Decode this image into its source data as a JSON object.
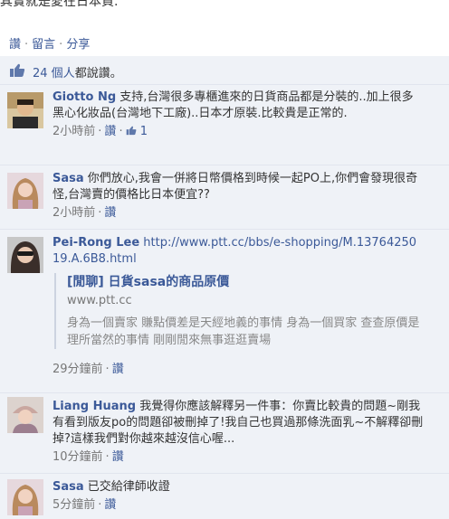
{
  "post": {
    "truncated_text": "其實就是愛在日本買.",
    "actions": {
      "like": "讚",
      "comment": "留言",
      "share": "分享"
    }
  },
  "likes": {
    "count": "24 個人",
    "suffix": "都說讚。"
  },
  "comments": [
    {
      "author": "Giotto Ng",
      "text": "支持,台灣很多專櫃進來的日貨商品都是分裝的..加上很多黑心化妝品(台灣地下工廠)..日本才原裝.比較貴是正常的.",
      "time": "2小時前",
      "like_label": "讚",
      "like_count": "1"
    },
    {
      "author": "Sasa",
      "text": "你們放心,我會一併將日幣價格到時候一起PO上,你們會發現很奇怪,台灣賣的價格比日本便宜??",
      "time": "2小時前",
      "like_label": "讚"
    },
    {
      "author": "Pei-Rong Lee",
      "url": "http://www.ptt.cc/bbs/e-shopping/M.1376425019.A.6B8.html",
      "share_title": "[閒聊] 日貨sasa的商品原價",
      "share_domain": "www.ptt.cc",
      "share_desc": "身為一個賣家 賺點價差是天經地義的事情 身為一個買家 查查原價是理所當然的事情 剛剛閒來無事逛逛賣場",
      "time": "29分鐘前",
      "like_label": "讚"
    },
    {
      "author": "Liang Huang",
      "text": "我覺得你應該解釋另一件事：你賣比較貴的問題~剛我有看到版友po的問題卻被刪掉了!我自己也買過那條洗面乳~不解釋卻刪掉?這樣我們對你越來越沒信心喔...",
      "time": "10分鐘前",
      "like_label": "讚"
    },
    {
      "author": "Sasa",
      "text": "已交給律師收證",
      "time": "5分鐘前",
      "like_label": "讚"
    }
  ],
  "colors": {
    "link": "#3b5998",
    "panel": "#eff2f7",
    "text": "#333333",
    "meta": "#777777"
  }
}
